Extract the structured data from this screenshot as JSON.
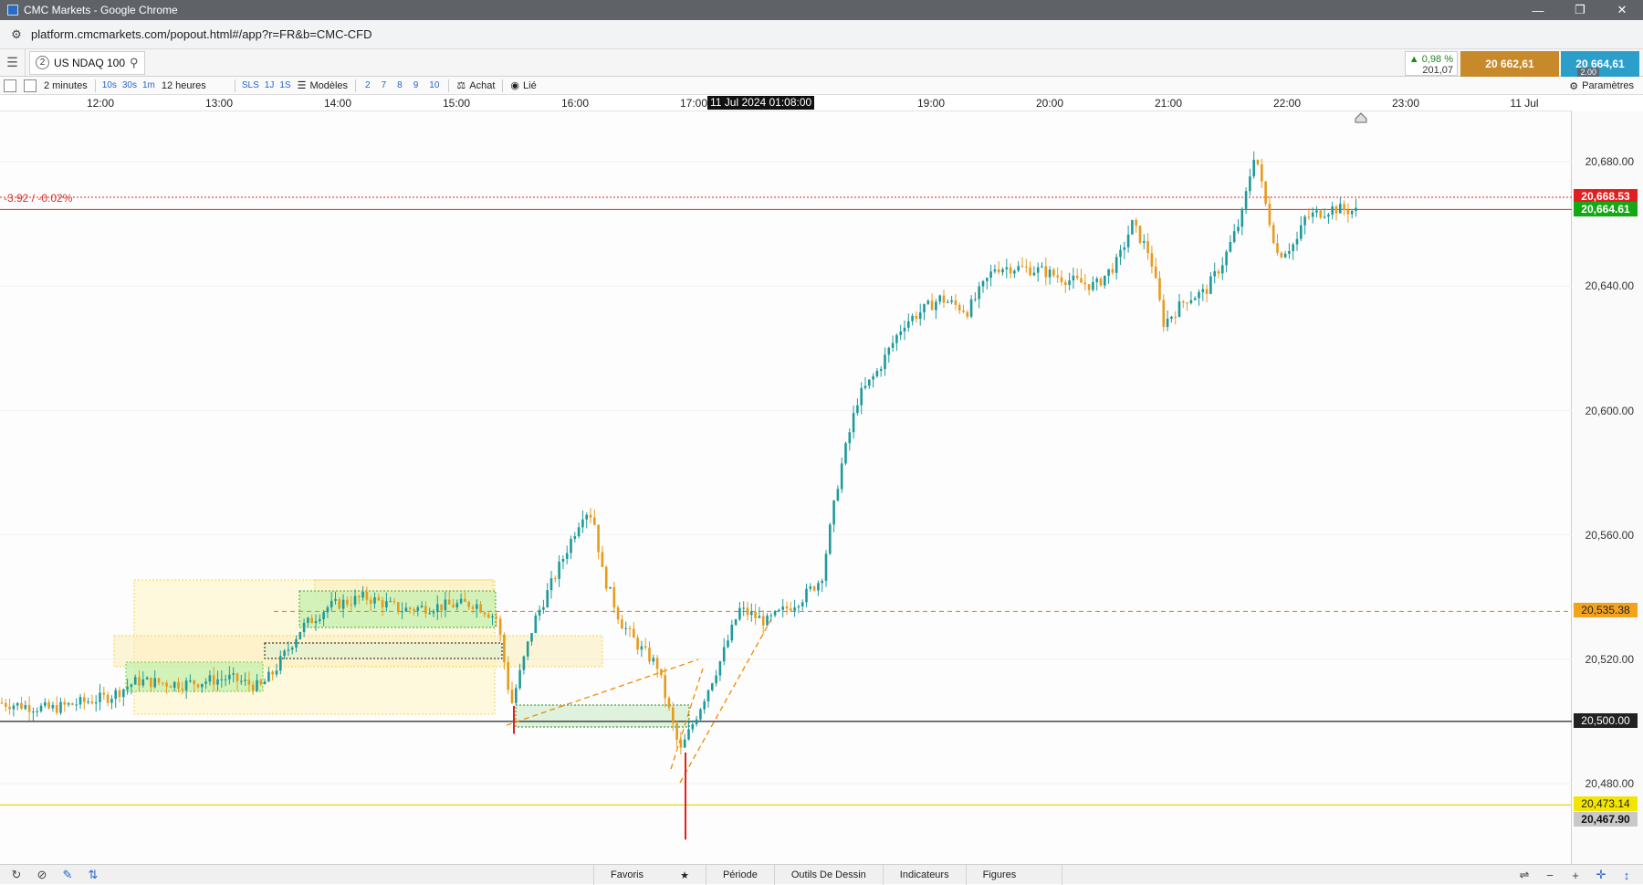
{
  "window": {
    "title": "CMC Markets - Google Chrome",
    "url": "platform.cmcmarkets.com/popout.html#/app?r=FR&b=CMC-CFD"
  },
  "instrument": {
    "tab_number": "2",
    "name": "US NDAQ 100",
    "change_pct": "▲ 0,98 %",
    "change_abs": "201,07",
    "sell_price": "20 662,61",
    "buy_price": "20 664,61",
    "spread": "2.00"
  },
  "toolbar": {
    "interval": "2 minutes",
    "quick_intervals": [
      "10s",
      "30s",
      "1m"
    ],
    "range": "12 heures",
    "quick_ranges": [
      "SLS",
      "1J",
      "1S"
    ],
    "models_label": "Modèles",
    "model_slots": [
      "2",
      "7",
      "8",
      "9",
      "10"
    ],
    "buy_label": "Achat",
    "linked_label": "Lié",
    "settings_label": "Paramètres"
  },
  "time_axis": {
    "ticks": [
      "12:00",
      "13:00",
      "14:00",
      "15:00",
      "16:00",
      "17:00",
      "19:00",
      "20:00",
      "21:00",
      "22:00",
      "23:00",
      "11 Jul"
    ],
    "cursor_time": "11 Jul 2024 01:08:00"
  },
  "price_axis": {
    "labels": [
      "20,680.00",
      "20,640.00",
      "20,600.00",
      "20,560.00",
      "20,520.00",
      "20,480.00"
    ]
  },
  "price_tags": {
    "sell_tag": "20,668.53",
    "buy_tag": "20,664.61",
    "orange_level": "20,535.38",
    "black_level": "20,500.00",
    "yellow_level": "20,473.14",
    "gray_level": "20,467.90"
  },
  "colors": {
    "bull": "#1e9a9a",
    "bear": "#e89a1c",
    "sell_red": "#e02020",
    "buy_green": "#14a814",
    "orange_line": "#f08a00",
    "yellow_line": "#e6d800",
    "black_line": "#222222",
    "gray_tag": "#c8c8c8"
  },
  "chart": {
    "change_label": "-3.92 / -0.02%"
  },
  "bottom_tabs": [
    "Favoris",
    "Période",
    "Outils De Dessin",
    "Indicateurs",
    "Figures"
  ]
}
